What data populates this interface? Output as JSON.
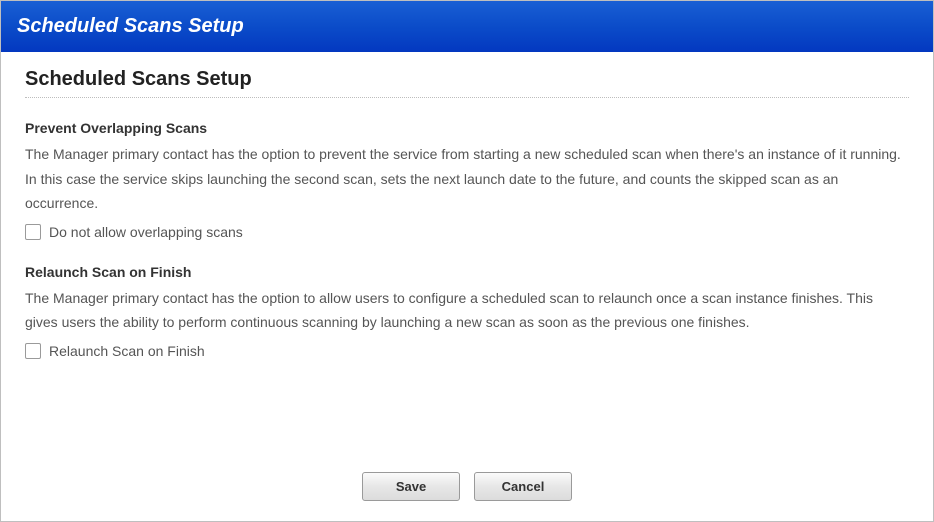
{
  "window": {
    "title": "Scheduled Scans Setup"
  },
  "page": {
    "heading": "Scheduled Scans Setup"
  },
  "sections": {
    "prevent_overlap": {
      "title": "Prevent Overlapping Scans",
      "description": "The Manager primary contact has the option to prevent the service from starting a new scheduled scan when there's an instance of it running. In this case the service skips launching the second scan, sets the next launch date to the future, and counts the skipped scan as an occurrence.",
      "checkbox_label": "Do not allow overlapping scans",
      "checked": false
    },
    "relaunch": {
      "title": "Relaunch Scan on Finish",
      "description": "The Manager primary contact has the option to allow users to configure a scheduled scan to relaunch once a scan instance finishes. This gives users the ability to perform continuous scanning by launching a new scan as soon as the previous one finishes.",
      "checkbox_label": "Relaunch Scan on Finish",
      "checked": false
    }
  },
  "buttons": {
    "save": "Save",
    "cancel": "Cancel"
  }
}
